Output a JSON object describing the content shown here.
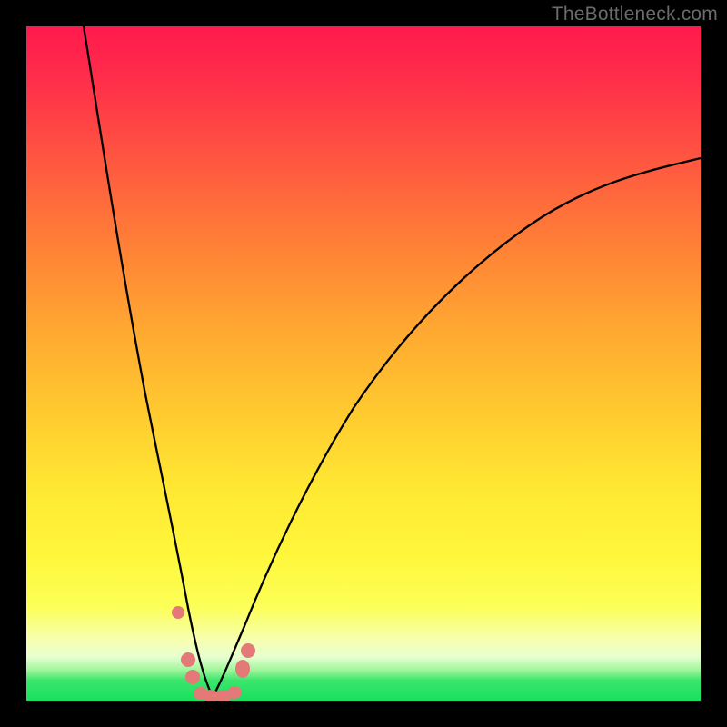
{
  "attribution": "TheBottleneck.com",
  "chart_data": {
    "type": "line",
    "title": "",
    "xlabel": "",
    "ylabel": "",
    "x_range": [
      0,
      100
    ],
    "y_range": [
      0,
      100
    ],
    "note": "Axes are unlabeled; values below are estimated from pixel positions on a 0–100 normalized scale where y=0 is the bottom (green) and y=100 is the top (red). Curve is a V-shaped profile with minimum near x≈27.",
    "series": [
      {
        "name": "left-branch",
        "x": [
          8.5,
          10,
          12,
          14,
          16,
          18,
          20,
          22,
          23.5,
          25,
          26,
          27,
          28
        ],
        "y": [
          100,
          88,
          71,
          57,
          45,
          34,
          24,
          15,
          10,
          5,
          2,
          0.5,
          0.3
        ]
      },
      {
        "name": "right-branch",
        "x": [
          28,
          30,
          32,
          35,
          40,
          45,
          50,
          55,
          60,
          65,
          70,
          75,
          80,
          85,
          90,
          95,
          100
        ],
        "y": [
          0.3,
          2,
          6,
          12,
          22,
          31,
          39,
          46,
          52,
          57,
          62,
          66,
          70,
          73,
          76,
          78.5,
          80.5
        ]
      }
    ],
    "markers": [
      {
        "name": "marker-left-upper",
        "x": 22.4,
        "y": 13.0
      },
      {
        "name": "marker-left-mid",
        "x": 24.0,
        "y": 6.2
      },
      {
        "name": "marker-left-low",
        "x": 24.6,
        "y": 3.5
      },
      {
        "name": "marker-bottom-1",
        "x": 25.8,
        "y": 0.8
      },
      {
        "name": "marker-bottom-2",
        "x": 27.2,
        "y": 0.4
      },
      {
        "name": "marker-bottom-3",
        "x": 29.2,
        "y": 0.4
      },
      {
        "name": "marker-bottom-4",
        "x": 30.8,
        "y": 0.9
      },
      {
        "name": "marker-right-low",
        "x": 32.0,
        "y": 4.8
      },
      {
        "name": "marker-right-up",
        "x": 32.8,
        "y": 7.5
      }
    ],
    "background_gradient_stops": [
      {
        "pos": 0.0,
        "color": "#ff1a4d"
      },
      {
        "pos": 0.45,
        "color": "#ffa831"
      },
      {
        "pos": 0.78,
        "color": "#fff63a"
      },
      {
        "pos": 0.95,
        "color": "#9df59a"
      },
      {
        "pos": 1.0,
        "color": "#18e05e"
      }
    ]
  }
}
